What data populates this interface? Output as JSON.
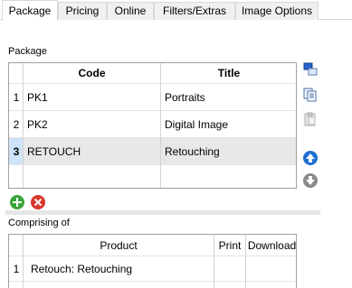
{
  "tabs": [
    {
      "label": "Package"
    },
    {
      "label": "Pricing"
    },
    {
      "label": "Online"
    },
    {
      "label": "Filters/Extras"
    },
    {
      "label": "Image Options"
    }
  ],
  "package_section": {
    "label": "Package",
    "columns": {
      "code": "Code",
      "title": "Title"
    },
    "rows": [
      {
        "num": "1",
        "code": "PK1",
        "title": "Portraits"
      },
      {
        "num": "2",
        "code": "PK2",
        "title": "Digital Image"
      },
      {
        "num": "3",
        "code": "RETOUCH",
        "title": "Retouching"
      }
    ]
  },
  "comprising_section": {
    "label": "Comprising of",
    "columns": {
      "product": "Product",
      "print": "Print",
      "download": "Download"
    },
    "rows": [
      {
        "num": "1",
        "product": "Retouch: Retouching"
      }
    ]
  },
  "colors": {
    "add_green": "#3aa53a",
    "delete_red": "#d9362b",
    "nav_blue": "#1f6fd0",
    "nav_grey": "#8a8a8a",
    "selection_row": "#e8e8e8"
  }
}
